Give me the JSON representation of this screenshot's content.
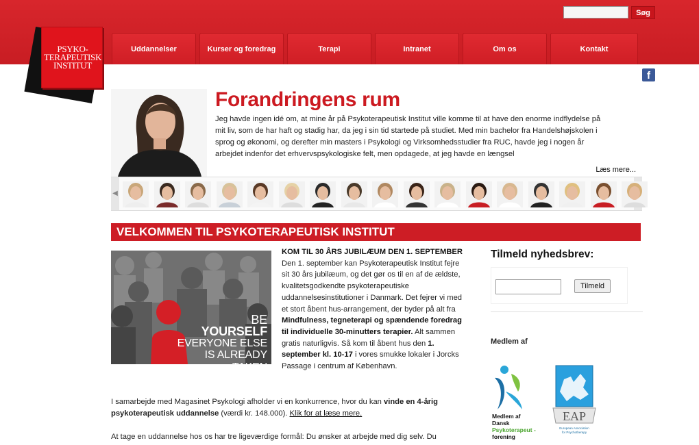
{
  "header": {
    "search_button": "Søg",
    "logo_lines": [
      "PSYKO-",
      "TERAPEUTISK",
      "INSTITUT"
    ],
    "nav": [
      "Uddannelser",
      "Kurser og foredrag",
      "Terapi",
      "Intranet",
      "Om os",
      "Kontakt"
    ],
    "facebook": "f"
  },
  "hero": {
    "title": "Forandringens rum",
    "text": "Jeg havde ingen idé om, at mine år på Psykoterapeutisk Institut ville komme til at have den enorme indflydelse på mit liv, som de har haft og stadig har, da jeg i sin tid startede på studiet. Med min bachelor fra Handelshøjskolen i sprog og økonomi, og derefter min masters i Psykologi og Virksomhedsstudier fra RUC, havde jeg i nogen år arbejdet indenfor det erhvervspsykologiske felt, men opdagede, at jeg havde en længsel",
    "read_more": "Læs mere..."
  },
  "welcome": "VELKOMMEN TIL PSYKOTERAPEUTISK INSTITUT",
  "promo_lines": [
    "BE",
    "YOURSELF",
    "EVERYONE ELSE",
    "IS ALREADY TAKEN"
  ],
  "article": {
    "heading": "KOM TIL 30 ÅRS JUBILÆUM DEN 1. SEPTEMBER",
    "p1": "Den 1. september kan Psykoterapeutisk Institut fejre sit 30 års jubilæum, og det gør os til en af de ældste, kvalitetsgodkendte psykoterapeutiske uddannelsesinstitutioner i Danmark. Det fejrer vi med et stort åbent hus-arrangement, der byder på alt fra ",
    "bold1": "Mindfulness, tegneterapi og spændende foredrag til individuelle 30-minutters terapier.",
    "p2": " Alt sammen gratis naturligvis. Så kom til åbent hus den ",
    "bold2": "1. september kl. 10-17",
    "p3": " i vores smukke lokaler i Jorcks Passage i centrum af København."
  },
  "contest": {
    "t1": "I samarbejde med Magasinet Psykologi afholder vi en konkurrence, hvor du kan ",
    "b1": "vinde en 4-årig psykoterapeutisk uddannelse",
    "t2": " (værdi kr. 148.000). ",
    "link": "Klik for at læse mere."
  },
  "bottom_para": "At tage en uddannelse hos os har tre ligeværdige formål: Du ønsker at arbejde med dig selv. Du",
  "sidebar": {
    "newsletter_title": "Tilmeld nyhedsbrev:",
    "subscribe": "Tilmeld",
    "member_title": "Medlem af",
    "dp_text": [
      "Medlem af",
      "Dansk",
      "Psykoterapeut -",
      "forening"
    ],
    "eap_label": "EAP",
    "eap_sub": [
      "European Association",
      "for Psychotherapy"
    ]
  }
}
